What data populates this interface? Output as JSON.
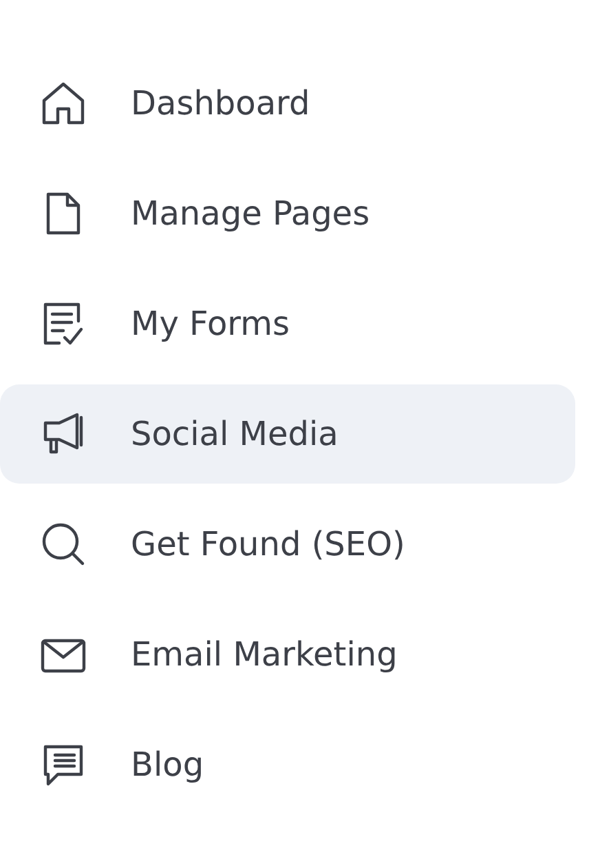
{
  "nav": {
    "items": [
      {
        "label": "Dashboard",
        "kind": "house",
        "selected": false
      },
      {
        "label": "Manage Pages",
        "kind": "page",
        "selected": false
      },
      {
        "label": "My Forms",
        "kind": "form",
        "selected": false
      },
      {
        "label": "Social Media",
        "kind": "megaphone",
        "selected": true
      },
      {
        "label": "Get Found (SEO)",
        "kind": "search",
        "selected": false
      },
      {
        "label": "Email Marketing",
        "kind": "envelope",
        "selected": false
      },
      {
        "label": "Blog",
        "kind": "chat",
        "selected": false
      }
    ]
  }
}
